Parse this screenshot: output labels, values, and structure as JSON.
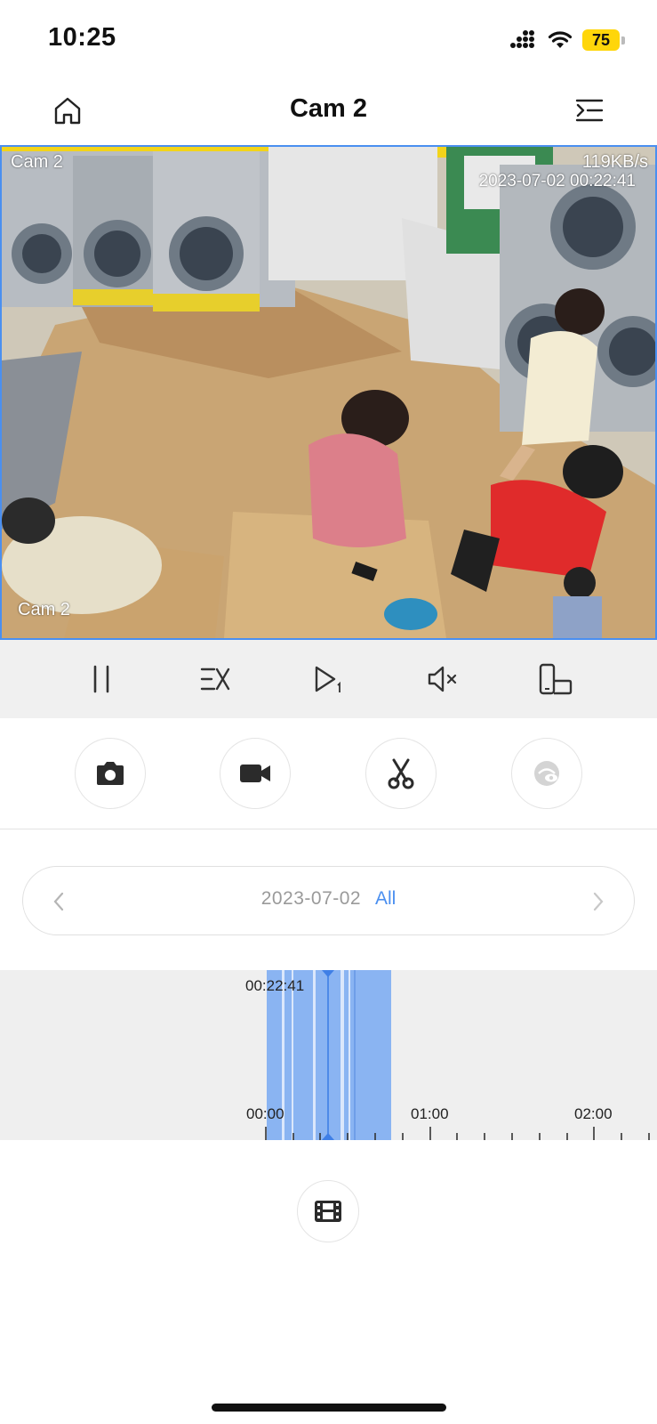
{
  "status_bar": {
    "time": "10:25",
    "battery_level": "75",
    "icons": [
      "cellular-signal-icon",
      "wifi-icon",
      "battery-icon"
    ]
  },
  "nav": {
    "title": "Cam 2",
    "left_icon": "home-icon",
    "right_icon": "menu-collapse-icon"
  },
  "video": {
    "channel_label_top": "Cam 2",
    "bitrate": "119KB/s",
    "timestamp": "2023-07-02 00:22:41",
    "channel_label_bottom": "Cam 2"
  },
  "controls": [
    {
      "name": "pause",
      "icon": "pause-icon"
    },
    {
      "name": "playback-speed",
      "icon": "speed-x-icon"
    },
    {
      "name": "play-single-frame",
      "icon": "play-step-icon"
    },
    {
      "name": "mute",
      "icon": "speaker-muted-icon"
    },
    {
      "name": "fullscreen-rotate",
      "icon": "rotate-screen-icon"
    }
  ],
  "actions": [
    {
      "name": "snapshot",
      "icon": "camera-icon"
    },
    {
      "name": "record",
      "icon": "video-camera-icon"
    },
    {
      "name": "clip",
      "icon": "scissors-icon"
    },
    {
      "name": "privacy",
      "icon": "eye-hidden-icon",
      "disabled": true
    }
  ],
  "date_selector": {
    "date": "2023-07-02",
    "filter": "All"
  },
  "timeline": {
    "current_time": "00:22:41",
    "tick_labels": [
      "00:00",
      "01:00",
      "02:00"
    ]
  },
  "clips_icon": "film-strip-icon",
  "colors": {
    "accent": "#4a8ff0",
    "recording_segment": "#8ab4f2",
    "control_bar_bg": "#f0f0f0",
    "battery": "#ffd60a"
  }
}
